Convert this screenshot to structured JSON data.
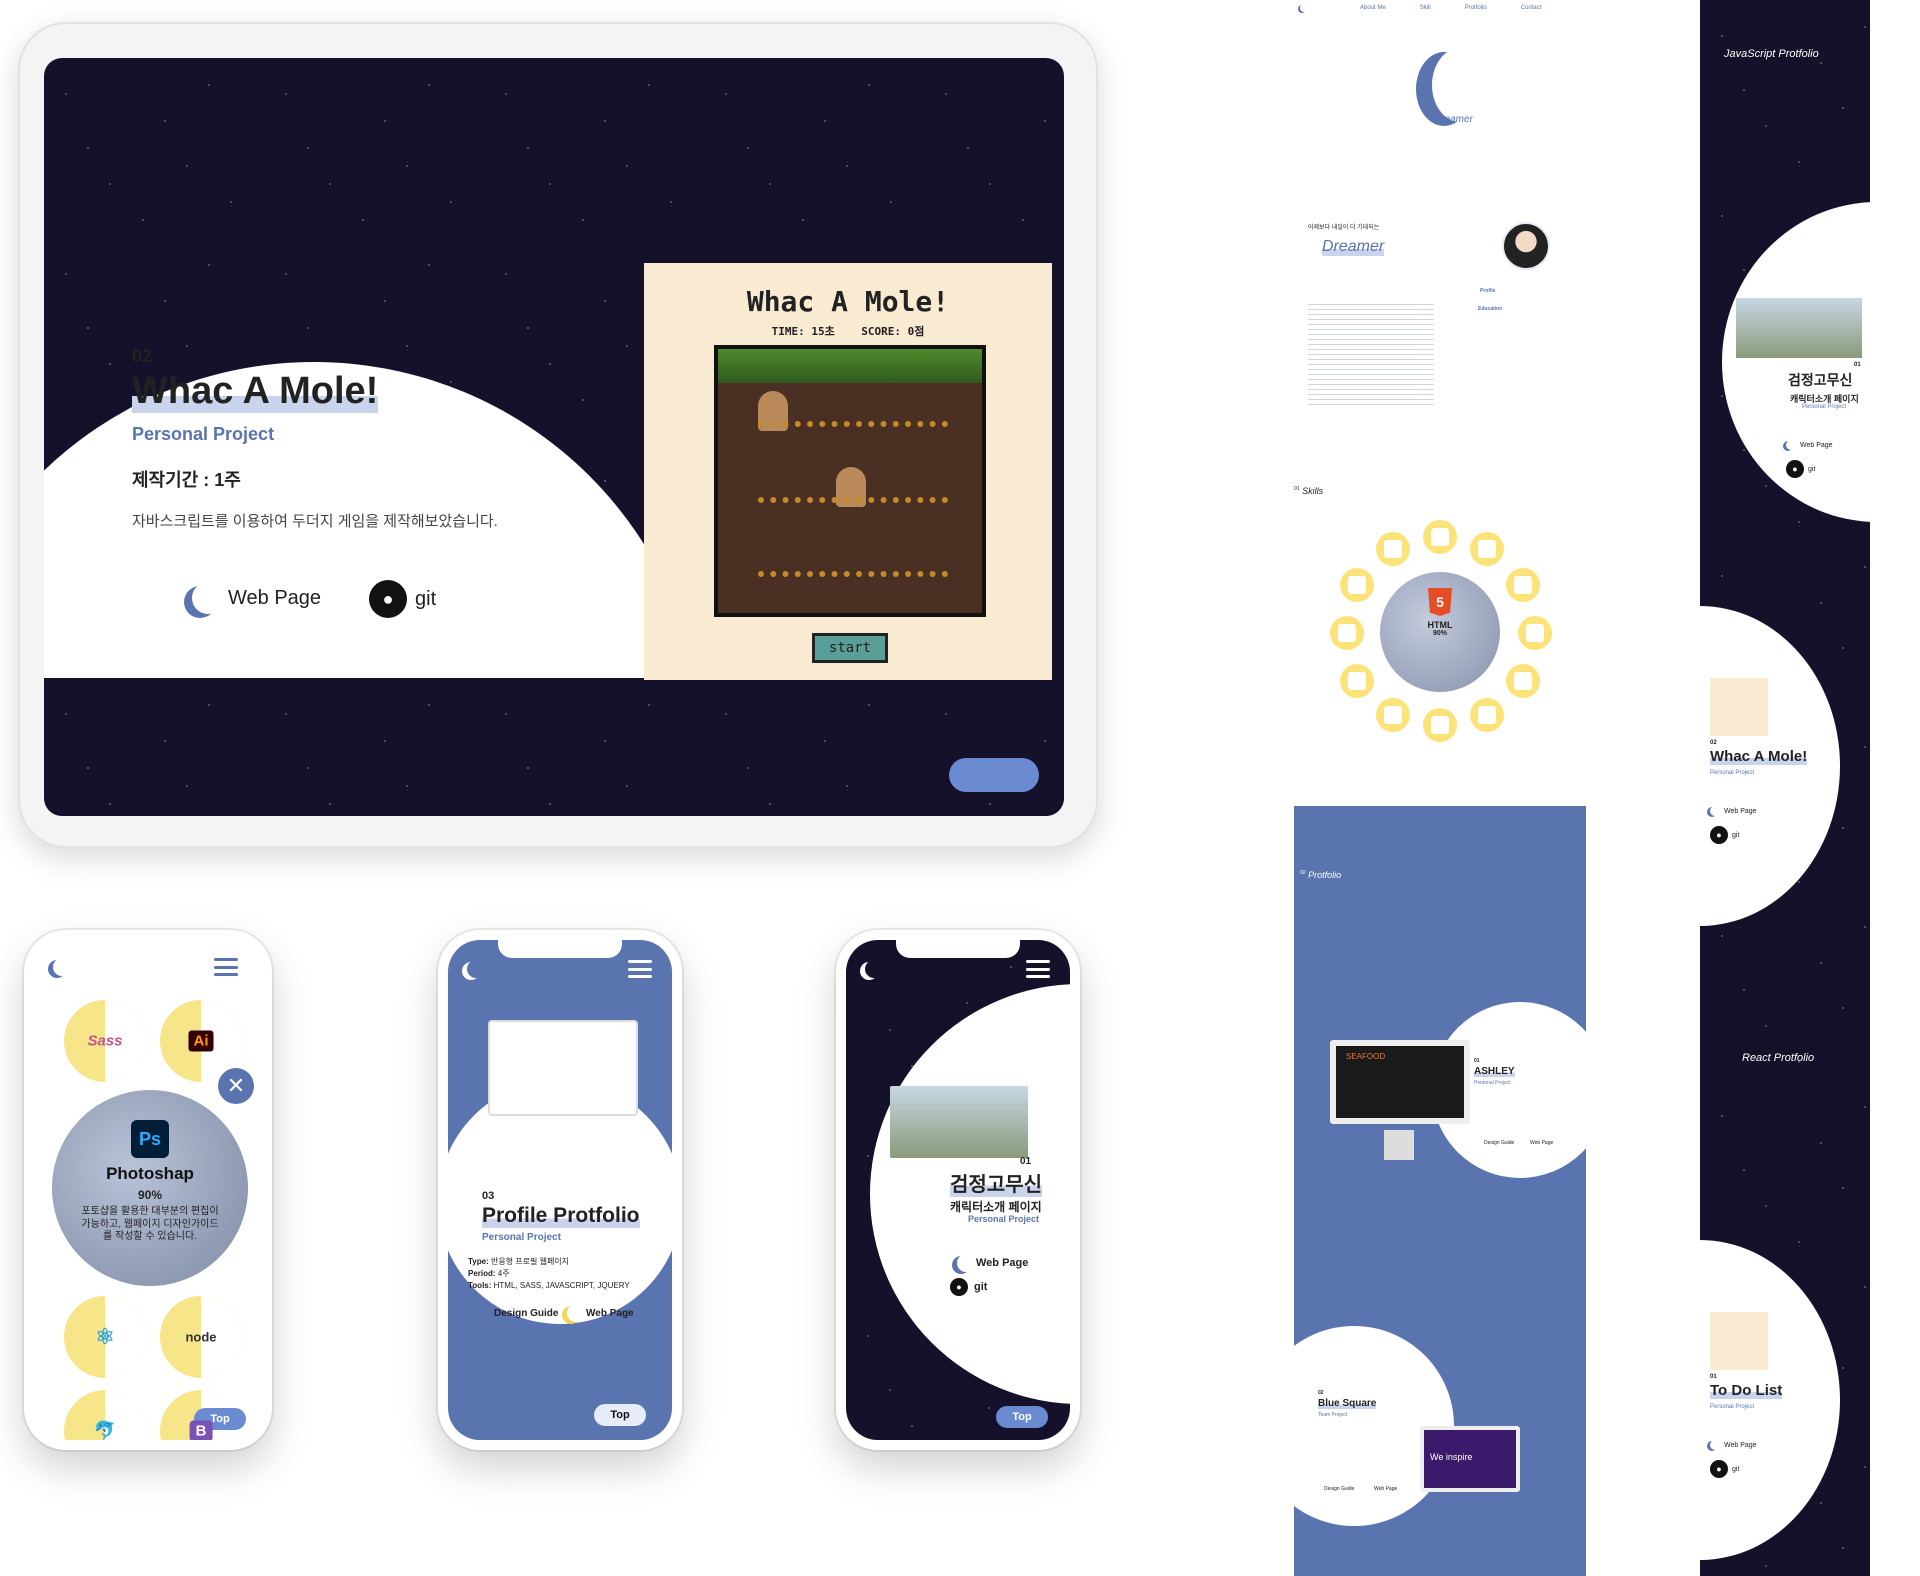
{
  "tablet": {
    "number": "02",
    "title": "Whac A Mole!",
    "subtitle": "Personal Project",
    "period": "제작기간 : 1주",
    "description": "자바스크립트를 이용하여 두더지 게임을 제작해보았습니다.",
    "web_label": "Web Page",
    "git_label": "git",
    "game": {
      "title": "Whac A Mole!",
      "time": "TIME: 15초",
      "score": "SCORE: 0점",
      "start": "start"
    }
  },
  "phone1": {
    "skill_name": "Photoshap",
    "skill_percent": "90%",
    "skill_desc": "포토샵을 활용한 대부분의 편집이 가능하고, 웹페이지 디자인가이드를 작성할 수 있습니다.",
    "chips": [
      "Sass",
      "Ai",
      "node",
      "B"
    ],
    "top": "Top"
  },
  "phone2": {
    "number": "03",
    "title": "Profile Protfolio",
    "subtitle": "Personal Project",
    "type_k": "Type:",
    "type_v": "반응형 프로필 웹페이지",
    "period_k": "Period:",
    "period_v": "4주",
    "tools_k": "Tools:",
    "tools_v": "HTML, SASS, JAVASCRIPT, JQUERY",
    "design_label": "Design Guide",
    "web_label": "Web Page",
    "top": "Top"
  },
  "phone3": {
    "number": "01",
    "title": "검정고무신",
    "subtitle": "캐릭터소개 페이지",
    "project": "Personal Project",
    "web_label": "Web Page",
    "git_label": "git",
    "top": "Top"
  },
  "desktop": {
    "nav": [
      "About Me",
      "Skill",
      "Protfolio",
      "Contact"
    ],
    "logo_text": "Dreamer",
    "about_lead": "어제보다 내일이 더 기대되는",
    "about_title": "Dreamer",
    "profile_label": "Profile",
    "education_label": "Education",
    "skills_label": "Skills",
    "skills_num": "01",
    "html_label": "HTML",
    "html_percent": "90%",
    "protfolio_label": "Protfolio",
    "protfolio_num": "02",
    "ashley": {
      "number": "01",
      "title": "ASHLEY",
      "subtitle": "Personal Project",
      "design": "Design Guide",
      "web": "Web Page",
      "seafood": "SEAFOOD"
    },
    "blue": {
      "number": "02",
      "title": "Blue Square",
      "subtitle": "Team Project",
      "design": "Design Guide",
      "web": "Web Page",
      "inspire": "We inspire"
    }
  },
  "strip": {
    "js_heading": "JavaScript Protfolio",
    "react_heading": "React Protfolio",
    "items": [
      {
        "number": "01",
        "title": "검정고무신",
        "subtitle": "캐릭터소개 페이지",
        "project": "Personal Project",
        "web": "Web Page",
        "git": "git"
      },
      {
        "number": "02",
        "title": "Whac A Mole!",
        "project": "Personal Project",
        "web": "Web Page",
        "git": "git"
      },
      {
        "number": "01",
        "title": "To Do List",
        "project": "Personal Project",
        "web": "Web Page",
        "git": "git"
      }
    ]
  },
  "colors": {
    "navy": "#15112b",
    "blue": "#5a74b0",
    "yellow": "#f7e58a",
    "cream": "#f9ead2"
  }
}
